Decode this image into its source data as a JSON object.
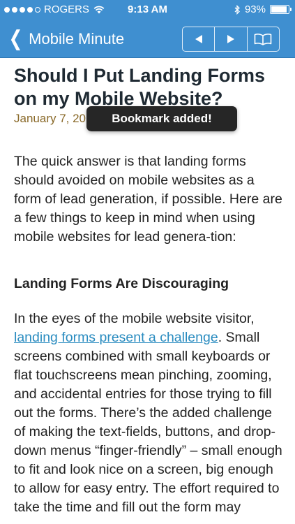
{
  "status": {
    "carrier": "ROGERS",
    "time": "9:13 AM",
    "battery": "93%",
    "battery_level": 0.93,
    "signal_bars": 4
  },
  "nav": {
    "back_label": "Mobile Minute",
    "buttons": [
      "prev-arrow",
      "next-arrow",
      "bookmark-book"
    ]
  },
  "article": {
    "title": "Should I Put Landing Forms on my Mobile Website?",
    "date": "January 7, 20",
    "para1": "The quick answer is that landing forms should avoided on mobile websites as a form of lead generation, if possible. Here are a few things to keep in mind when using mobile websites for lead genera-tion:",
    "heading": "Landing Forms Are Discouraging",
    "para2_before": "In the eyes of the mobile website visitor, ",
    "para2_link": "landing forms present a challenge",
    "para2_after": ". Small screens combined with small keyboards or flat touchscreens mean pinching, zooming, and accidental entries for those trying to fill out the forms. There’s the added challenge of making the text-fields, buttons, and drop-down menus “finger-friendly” – small enough to fit and look nice on a screen, big enough to allow for easy entry. The effort required to take the time and fill out the form may"
  },
  "toast": {
    "message": "Bookmark added!"
  }
}
